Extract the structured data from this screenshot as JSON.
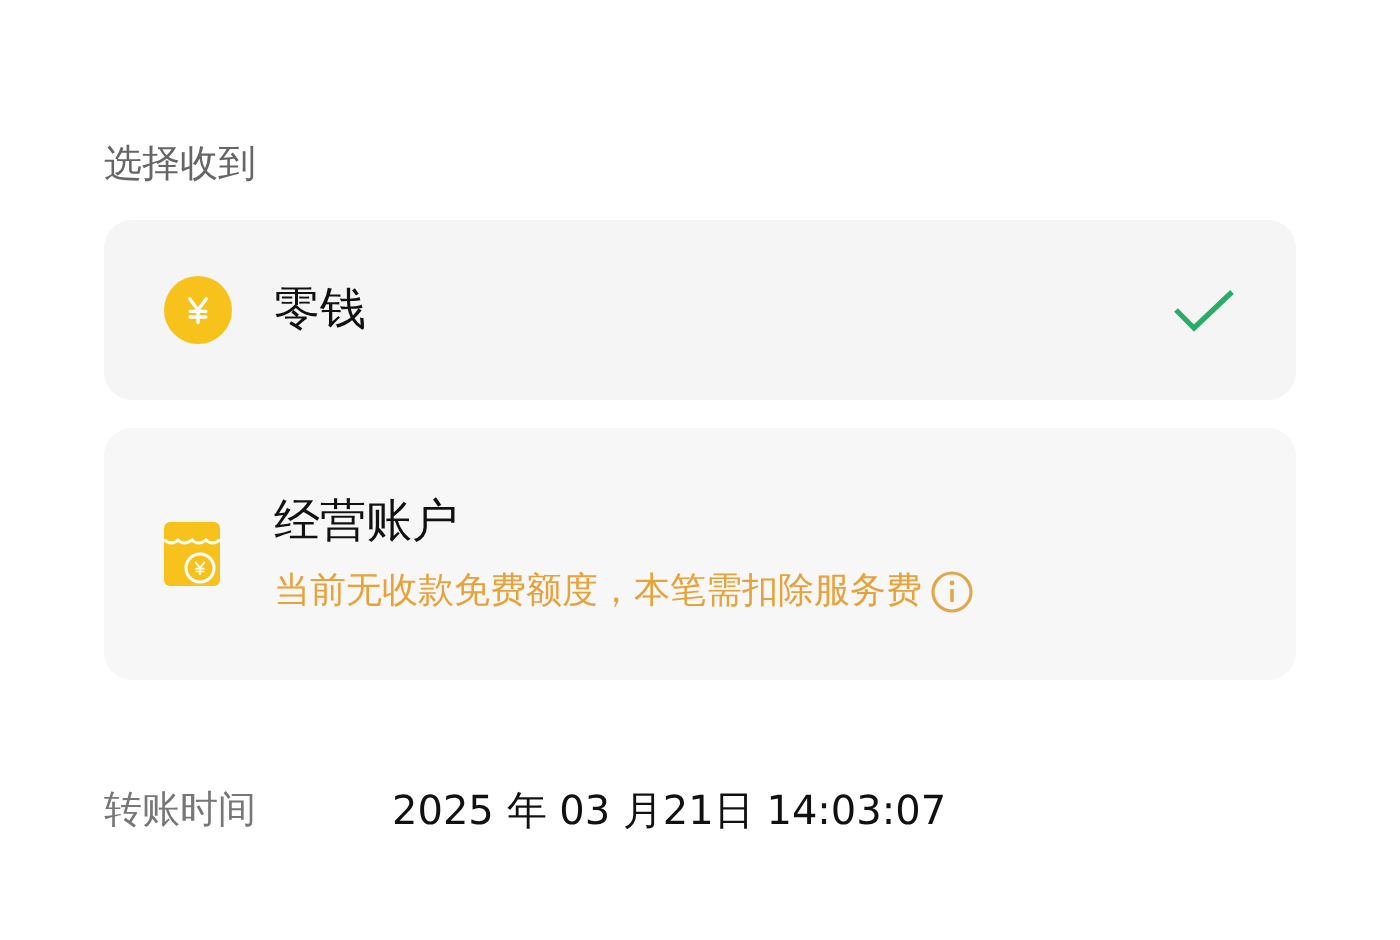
{
  "section_label": "选择收到",
  "options": [
    {
      "kind": "change",
      "title": "零钱",
      "selected": true
    },
    {
      "kind": "business",
      "title": "经营账户",
      "note": "当前无收款免费额度，本笔需扣除服务费",
      "selected": false
    }
  ],
  "transfer_time": {
    "label": "转账时间",
    "value": "2025 年 03 月21日 14:03:07"
  }
}
